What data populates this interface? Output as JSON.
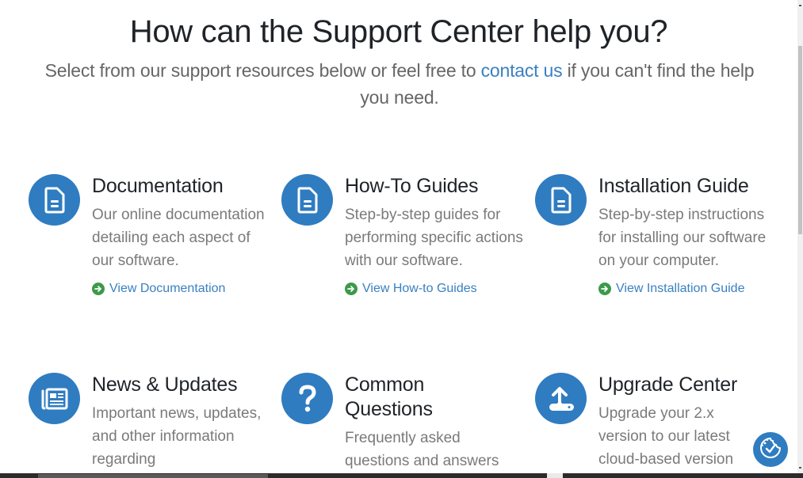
{
  "hero": {
    "title": "How can the Support Center help you?",
    "subtitle_before": "Select from our support resources below or feel free to ",
    "subtitle_link": "contact us",
    "subtitle_after": " if you can't find the help you need."
  },
  "colors": {
    "accent_blue": "#2f7cc1",
    "link_blue": "#3a80c0",
    "arrow_green": "#3c9a49",
    "title_text": "#1f2328",
    "body_text": "#7a7a7a"
  },
  "cards": [
    {
      "icon": "document-icon",
      "title": "Documentation",
      "description": "Our online documentation detailing each aspect of our software.",
      "link": "View Documentation"
    },
    {
      "icon": "document-icon",
      "title": "How-To Guides",
      "description": "Step-by-step guides for performing specific actions with our software.",
      "link": "View How-to Guides"
    },
    {
      "icon": "document-icon",
      "title": "Installation Guide",
      "description": "Step-by-step instructions for installing our software on your computer.",
      "link": "View Installation Guide"
    },
    {
      "icon": "newspaper-icon",
      "title": "News & Updates",
      "description": "Important news, updates, and other information regarding"
    },
    {
      "icon": "question-icon",
      "title": "Common Questions",
      "description": "Frequently asked questions and answers"
    },
    {
      "icon": "upload-icon",
      "title": "Upgrade Center",
      "description": "Upgrade your 2.x version to our latest cloud-based version"
    }
  ],
  "floating": {
    "cookie_button_icon": "cookie-check-icon"
  }
}
